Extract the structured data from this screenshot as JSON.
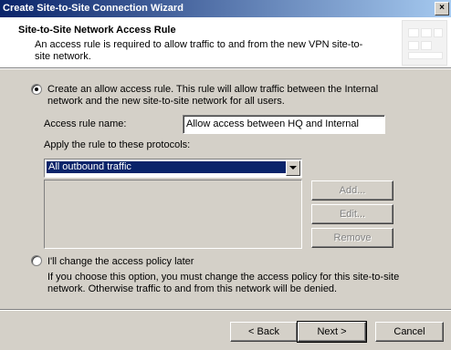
{
  "window": {
    "title": "Create Site-to-Site Connection Wizard",
    "close_glyph": "×"
  },
  "header": {
    "title": "Site-to-Site Network Access Rule",
    "description": "An access rule is required to allow traffic to and from the new VPN site-to-site network."
  },
  "option_create": {
    "label": "Create an allow access rule. This rule will allow traffic between the Internal network and the new site-to-site network for all users.",
    "selected": true
  },
  "rule_name": {
    "label": "Access rule name:",
    "value": "Allow access between HQ and Internal"
  },
  "protocols": {
    "label": "Apply the rule to these protocols:",
    "selected": "All outbound traffic"
  },
  "list_buttons": {
    "add": "Add...",
    "edit": "Edit...",
    "remove": "Remove"
  },
  "option_later": {
    "label": "I'll change the access policy later",
    "selected": false,
    "description": "If you choose this option, you must change the access policy for this site-to-site network. Otherwise traffic to and from this network will be denied."
  },
  "footer": {
    "back": "< Back",
    "next": "Next >",
    "cancel": "Cancel"
  }
}
